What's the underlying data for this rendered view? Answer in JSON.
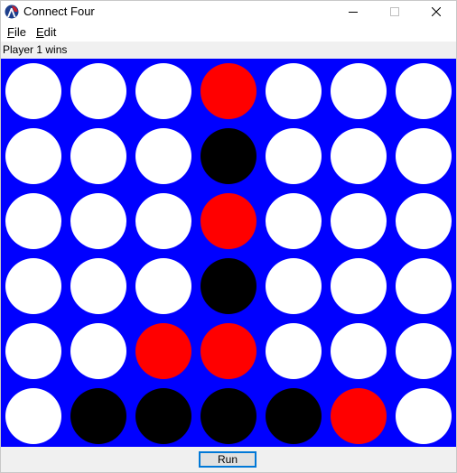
{
  "window": {
    "title": "Connect Four",
    "icon": "racket-logo-icon"
  },
  "menu": {
    "file_label": "File",
    "file_mnemonic": "F",
    "file_rest": "ile",
    "edit_label": "Edit",
    "edit_mnemonic": "E",
    "edit_rest": "dit"
  },
  "status": {
    "text": "Player 1 wins"
  },
  "board": {
    "rows": 6,
    "cols": 7,
    "colors": {
      "board": "#0000ff",
      "empty": "#ffffff",
      "red": "#ff0000",
      "black": "#000000"
    },
    "grid": [
      [
        "empty",
        "empty",
        "empty",
        "red",
        "empty",
        "empty",
        "empty"
      ],
      [
        "empty",
        "empty",
        "empty",
        "black",
        "empty",
        "empty",
        "empty"
      ],
      [
        "empty",
        "empty",
        "empty",
        "red",
        "empty",
        "empty",
        "empty"
      ],
      [
        "empty",
        "empty",
        "empty",
        "black",
        "empty",
        "empty",
        "empty"
      ],
      [
        "empty",
        "empty",
        "red",
        "red",
        "empty",
        "empty",
        "empty"
      ],
      [
        "empty",
        "black",
        "black",
        "black",
        "black",
        "red",
        "empty"
      ]
    ]
  },
  "controls": {
    "run_label": "Run"
  }
}
